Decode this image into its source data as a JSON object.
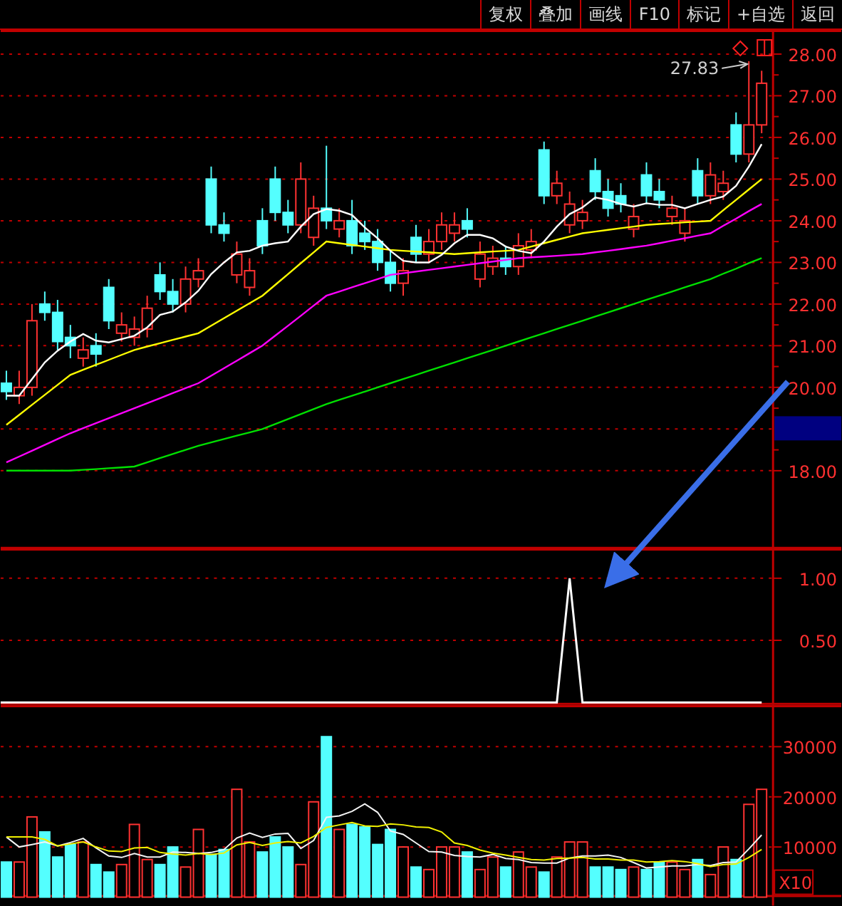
{
  "toolbar": {
    "buttons": [
      "复权",
      "叠加",
      "画线",
      "F10",
      "标记",
      "+自选",
      "返回"
    ]
  },
  "price_chart": {
    "high_label": "27.83",
    "chart_data": {
      "type": "candlestick",
      "grid": true,
      "ylim": [
        16.12,
        28.58
      ],
      "yticks": [
        {
          "value": 28,
          "label": "28.00"
        },
        {
          "value": 27,
          "label": "27.00"
        },
        {
          "value": 26,
          "label": "26.00"
        },
        {
          "value": 25,
          "label": "25.00"
        },
        {
          "value": 24,
          "label": "24.00"
        },
        {
          "value": 23,
          "label": "23.00"
        },
        {
          "value": 22,
          "label": "22.00"
        },
        {
          "value": 21,
          "label": "21.00"
        },
        {
          "value": 20,
          "label": "20.00"
        },
        {
          "value": 18,
          "label": "18.00"
        }
      ],
      "ohlc": [
        [
          20.1,
          20.4,
          19.7,
          19.9
        ],
        [
          19.8,
          20.4,
          19.6,
          20.0
        ],
        [
          20.0,
          22.0,
          19.8,
          21.6
        ],
        [
          22.0,
          22.3,
          21.6,
          21.8
        ],
        [
          21.8,
          22.1,
          20.9,
          21.1
        ],
        [
          21.2,
          21.5,
          20.7,
          21.0
        ],
        [
          20.7,
          21.2,
          20.5,
          20.9
        ],
        [
          21.0,
          21.3,
          20.5,
          20.8
        ],
        [
          22.4,
          22.6,
          21.4,
          21.6
        ],
        [
          21.3,
          21.8,
          21.1,
          21.5
        ],
        [
          21.2,
          21.7,
          21.0,
          21.4
        ],
        [
          21.4,
          22.2,
          21.2,
          21.9
        ],
        [
          22.7,
          23.0,
          22.1,
          22.3
        ],
        [
          22.3,
          22.6,
          21.8,
          22.0
        ],
        [
          22.0,
          22.9,
          21.8,
          22.6
        ],
        [
          22.6,
          23.1,
          22.4,
          22.8
        ],
        [
          25.0,
          25.3,
          23.7,
          23.9
        ],
        [
          23.9,
          24.2,
          23.5,
          23.7
        ],
        [
          22.7,
          23.5,
          22.5,
          23.2
        ],
        [
          22.4,
          23.1,
          22.2,
          22.8
        ],
        [
          24.0,
          24.3,
          23.2,
          23.4
        ],
        [
          25.0,
          25.3,
          24.0,
          24.2
        ],
        [
          24.2,
          24.5,
          23.7,
          23.9
        ],
        [
          23.9,
          25.4,
          23.7,
          25.0
        ],
        [
          23.6,
          24.6,
          23.4,
          24.3
        ],
        [
          24.3,
          25.8,
          23.8,
          24.0
        ],
        [
          23.8,
          24.3,
          23.6,
          24.0
        ],
        [
          24.0,
          24.5,
          23.2,
          23.4
        ],
        [
          23.7,
          24.0,
          23.3,
          23.5
        ],
        [
          23.5,
          23.8,
          22.8,
          23.0
        ],
        [
          23.0,
          23.3,
          22.3,
          22.5
        ],
        [
          22.5,
          23.1,
          22.2,
          22.8
        ],
        [
          23.6,
          23.9,
          23.0,
          23.2
        ],
        [
          23.2,
          23.8,
          23.0,
          23.5
        ],
        [
          23.5,
          24.2,
          23.3,
          23.9
        ],
        [
          23.7,
          24.2,
          23.5,
          23.9
        ],
        [
          24.0,
          24.3,
          23.6,
          23.8
        ],
        [
          22.6,
          23.5,
          22.4,
          23.2
        ],
        [
          22.9,
          23.4,
          22.7,
          23.1
        ],
        [
          23.1,
          23.4,
          22.7,
          22.9
        ],
        [
          22.9,
          23.7,
          22.7,
          23.4
        ],
        [
          23.3,
          23.8,
          23.1,
          23.5
        ],
        [
          25.7,
          25.9,
          24.4,
          24.6
        ],
        [
          24.6,
          25.2,
          24.4,
          24.9
        ],
        [
          23.9,
          24.7,
          23.7,
          24.4
        ],
        [
          24.0,
          24.5,
          23.8,
          24.2
        ],
        [
          25.2,
          25.5,
          24.5,
          24.7
        ],
        [
          24.7,
          25.0,
          24.1,
          24.3
        ],
        [
          24.6,
          24.9,
          24.2,
          24.4
        ],
        [
          23.8,
          24.4,
          23.6,
          24.1
        ],
        [
          25.1,
          25.4,
          24.4,
          24.6
        ],
        [
          24.7,
          25.0,
          24.3,
          24.5
        ],
        [
          24.1,
          24.6,
          23.9,
          24.3
        ],
        [
          23.7,
          24.3,
          23.5,
          24.0
        ],
        [
          25.2,
          25.5,
          24.4,
          24.6
        ],
        [
          24.6,
          25.4,
          24.4,
          25.1
        ],
        [
          24.7,
          25.2,
          24.5,
          24.9
        ],
        [
          26.3,
          26.6,
          25.4,
          25.6
        ],
        [
          25.6,
          27.83,
          25.4,
          26.3
        ],
        [
          26.3,
          27.6,
          26.1,
          27.3
        ]
      ],
      "series": [
        {
          "type": "line",
          "color": "#00e000",
          "values": [
            18.0,
            18.0,
            18.0,
            18.0,
            18.0,
            18.0,
            18.02,
            18.04,
            18.06,
            18.08,
            18.1,
            18.2,
            18.3,
            18.4,
            18.5,
            18.6,
            18.68,
            18.76,
            18.84,
            18.92,
            19.0,
            19.12,
            19.24,
            19.36,
            19.48,
            19.6,
            19.7,
            19.8,
            19.9,
            20.0,
            20.1,
            20.2,
            20.3,
            20.4,
            20.5,
            20.6,
            20.7,
            20.8,
            20.9,
            21.0,
            21.1,
            21.2,
            21.3,
            21.4,
            21.5,
            21.6,
            21.7,
            21.8,
            21.9,
            22.0,
            22.1,
            22.2,
            22.3,
            22.4,
            22.5,
            22.6,
            22.73,
            22.85,
            22.98,
            23.1
          ]
        },
        {
          "type": "line",
          "color": "#ff00ff",
          "values": [
            18.2,
            18.34,
            18.48,
            18.62,
            18.76,
            18.9,
            19.02,
            19.14,
            19.26,
            19.38,
            19.5,
            19.62,
            19.74,
            19.86,
            19.98,
            20.1,
            20.28,
            20.46,
            20.64,
            20.82,
            21.0,
            21.24,
            21.48,
            21.72,
            21.96,
            22.2,
            22.3,
            22.4,
            22.5,
            22.6,
            22.7,
            22.74,
            22.78,
            22.82,
            22.86,
            22.9,
            22.94,
            22.98,
            23.02,
            23.06,
            23.1,
            23.12,
            23.14,
            23.16,
            23.18,
            23.2,
            23.24,
            23.28,
            23.32,
            23.36,
            23.4,
            23.46,
            23.52,
            23.58,
            23.64,
            23.7,
            23.88,
            24.05,
            24.23,
            24.4
          ]
        },
        {
          "type": "line",
          "color": "#ffff00",
          "values": [
            19.1,
            19.34,
            19.58,
            19.82,
            20.06,
            20.3,
            20.42,
            20.54,
            20.66,
            20.78,
            20.9,
            20.98,
            21.06,
            21.14,
            21.22,
            21.3,
            21.48,
            21.66,
            21.84,
            22.02,
            22.2,
            22.46,
            22.72,
            22.98,
            23.24,
            23.5,
            23.46,
            23.42,
            23.38,
            23.34,
            23.3,
            23.28,
            23.26,
            23.24,
            23.22,
            23.2,
            23.22,
            23.24,
            23.26,
            23.28,
            23.3,
            23.38,
            23.46,
            23.54,
            23.62,
            23.7,
            23.74,
            23.78,
            23.82,
            23.86,
            23.9,
            23.92,
            23.94,
            23.96,
            23.98,
            24.0,
            24.25,
            24.5,
            24.75,
            25.0
          ]
        },
        {
          "type": "line",
          "color": "#ffffff",
          "values": [
            19.8,
            19.8,
            20.2,
            20.6,
            20.88,
            21.1,
            21.28,
            21.12,
            21.08,
            21.16,
            21.24,
            21.44,
            21.74,
            21.82,
            22.04,
            22.32,
            22.72,
            23.0,
            23.24,
            23.28,
            23.4,
            23.46,
            23.5,
            23.86,
            24.16,
            24.28,
            24.24,
            24.14,
            23.84,
            23.58,
            23.28,
            23.04,
            23.0,
            23.0,
            23.18,
            23.46,
            23.66,
            23.66,
            23.58,
            23.38,
            23.28,
            23.22,
            23.5,
            23.86,
            24.16,
            24.32,
            24.56,
            24.5,
            24.4,
            24.34,
            24.42,
            24.38,
            24.38,
            24.3,
            24.4,
            24.5,
            24.58,
            24.84,
            25.3,
            25.84
          ]
        }
      ]
    }
  },
  "indicator_chart": {
    "chart_data": {
      "type": "line",
      "grid": true,
      "ylim": [
        -0.02,
        1.24
      ],
      "yticks": [
        {
          "value": 0.5,
          "label": "0.50"
        },
        {
          "value": 1,
          "label": "1.00"
        }
      ],
      "series": [
        {
          "color": "#ffffff",
          "values": [
            0,
            0,
            0,
            0,
            0,
            0,
            0,
            0,
            0,
            0,
            0,
            0,
            0,
            0,
            0,
            0,
            0,
            0,
            0,
            0,
            0,
            0,
            0,
            0,
            0,
            0,
            0,
            0,
            0,
            0,
            0,
            0,
            0,
            0,
            0,
            0,
            0,
            0,
            0,
            0,
            0,
            0,
            0,
            0,
            1,
            0,
            0,
            0,
            0,
            0,
            0,
            0,
            0,
            0,
            0,
            0,
            0,
            0,
            0,
            0
          ]
        }
      ]
    }
  },
  "volume_chart": {
    "unit_label": "X10",
    "chart_data": {
      "type": "bar",
      "grid": true,
      "ylim": [
        0,
        38285
      ],
      "yticks": [
        {
          "value": 10000,
          "label": "10000"
        },
        {
          "value": 20000,
          "label": "20000"
        },
        {
          "value": 30000,
          "label": "30000"
        }
      ],
      "series": [
        {
          "type": "bar",
          "colors": [
            "#54ffff",
            "#ff3232",
            "#ff3232",
            "#54ffff",
            "#54ffff",
            "#54ffff",
            "#ff3232",
            "#54ffff",
            "#54ffff",
            "#ff3232",
            "#ff3232",
            "#ff3232",
            "#54ffff",
            "#54ffff",
            "#ff3232",
            "#ff3232",
            "#54ffff",
            "#54ffff",
            "#ff3232",
            "#ff3232",
            "#54ffff",
            "#54ffff",
            "#54ffff",
            "#ff3232",
            "#ff3232",
            "#54ffff",
            "#ff3232",
            "#54ffff",
            "#54ffff",
            "#54ffff",
            "#54ffff",
            "#ff3232",
            "#54ffff",
            "#ff3232",
            "#ff3232",
            "#ff3232",
            "#54ffff",
            "#ff3232",
            "#ff3232",
            "#54ffff",
            "#ff3232",
            "#ff3232",
            "#54ffff",
            "#ff3232",
            "#ff3232",
            "#ff3232",
            "#54ffff",
            "#54ffff",
            "#54ffff",
            "#ff3232",
            "#54ffff",
            "#54ffff",
            "#ff3232",
            "#ff3232",
            "#54ffff",
            "#ff3232",
            "#ff3232",
            "#54ffff",
            "#ff3232",
            "#ff3232"
          ],
          "values": [
            7000,
            7000,
            16000,
            13000,
            8000,
            10500,
            11000,
            6500,
            5000,
            6500,
            14500,
            7500,
            6500,
            10000,
            6000,
            13500,
            8500,
            9500,
            21500,
            11000,
            9000,
            12000,
            10000,
            6500,
            19000,
            32000,
            13500,
            14500,
            14000,
            10500,
            13500,
            10000,
            6000,
            5500,
            10000,
            10000,
            9000,
            5500,
            8000,
            6000,
            9000,
            6000,
            5000,
            8000,
            11000,
            11000,
            6000,
            6000,
            5500,
            6000,
            5500,
            7000,
            7000,
            5500,
            7500,
            4500,
            10000,
            7500,
            18500,
            21500
          ]
        },
        {
          "type": "line",
          "color": "#f4f4f4",
          "values": [
            12000,
            10000,
            10500,
            11000,
            10200,
            10900,
            11700,
            9800,
            8200,
            7900,
            8700,
            8000,
            8000,
            9000,
            8900,
            8700,
            8900,
            9500,
            11800,
            12800,
            11900,
            12600,
            12700,
            9700,
            11300,
            15900,
            16200,
            17100,
            18600,
            16900,
            13200,
            12500,
            10800,
            9100,
            9000,
            8300,
            8100,
            8000,
            8500,
            7700,
            7500,
            6900,
            6800,
            6800,
            7800,
            8200,
            8200,
            8400,
            7900,
            6900,
            5800,
            6000,
            6200,
            6200,
            6500,
            6300,
            6900,
            7000,
            9600,
            12400
          ]
        },
        {
          "type": "line",
          "color": "#f0f000",
          "values": [
            12000,
            12000,
            12000,
            11500,
            10200,
            10600,
            11000,
            10000,
            9200,
            9100,
            9800,
            9900,
            8900,
            8600,
            8400,
            8700,
            8500,
            8800,
            10400,
            10900,
            10300,
            10800,
            11100,
            10800,
            12100,
            13900,
            14400,
            14900,
            14200,
            14100,
            14600,
            14400,
            14000,
            13900,
            13000,
            10800,
            10300,
            9400,
            8800,
            8400,
            7900,
            7500,
            7400,
            7700,
            7800,
            7900,
            7600,
            7600,
            7400,
            7400,
            7000,
            7100,
            7300,
            7100,
            6700,
            6100,
            6500,
            6600,
            7900,
            9500
          ]
        }
      ]
    }
  }
}
